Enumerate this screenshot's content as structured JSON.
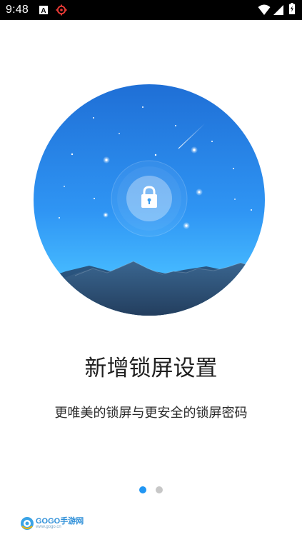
{
  "status_bar": {
    "time": "9:48",
    "left_icons": [
      "text-a-icon",
      "settings-gear-icon"
    ],
    "right_icons": [
      "wifi-icon",
      "signal-icon",
      "battery-charging-icon"
    ]
  },
  "hero": {
    "image": "lock-screen-illustration",
    "icon": "padlock-icon"
  },
  "onboarding": {
    "title": "新增锁屏设置",
    "subtitle": "更唯美的锁屏与更安全的锁屏密码"
  },
  "pager": {
    "total_pages": 2,
    "current_page": 1
  },
  "watermark": {
    "text": "GOGO手游网",
    "subtext": "www.gogo.cn"
  },
  "colors": {
    "status_bar": "#000000",
    "sky_top": "#1f6fd6",
    "sky_bottom": "#3fb0ff",
    "mountain": "#2f5279",
    "text": "#1f1f1f",
    "dot_active": "#2196f3",
    "dot_inactive": "#c7c7c7"
  }
}
